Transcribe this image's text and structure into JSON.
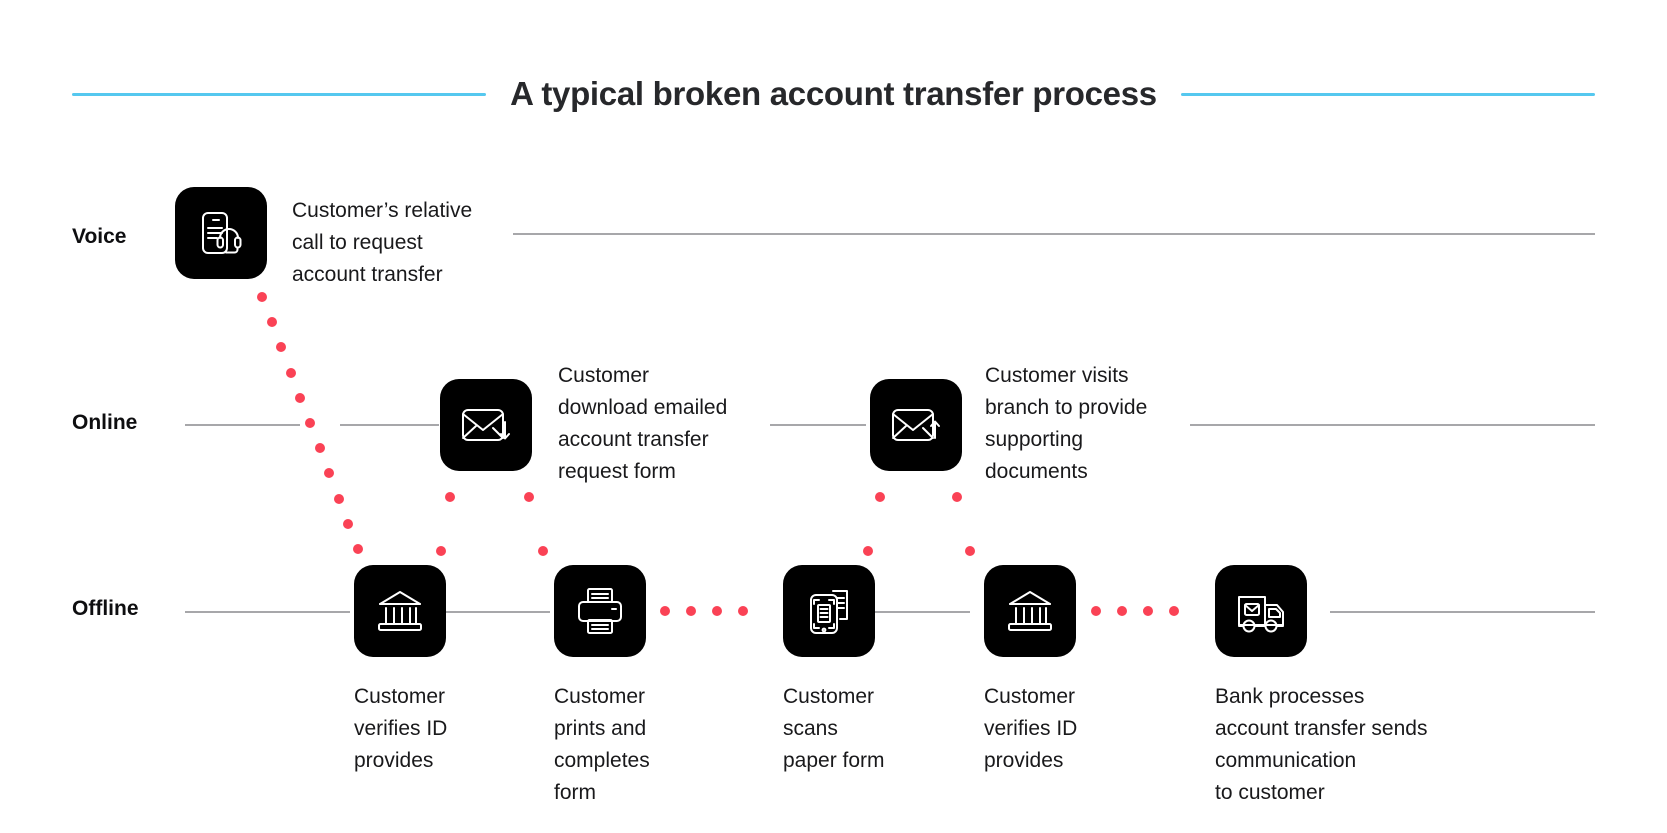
{
  "title": {
    "text": "A typical broken account transfer process",
    "rule_color": "#55c8ef"
  },
  "colors": {
    "accent_rule": "#55c8ef",
    "connector_dot": "#fa4255",
    "tile_background": "#000000",
    "track_line": "#a7a7aa",
    "text": "#19191b"
  },
  "lanes": [
    {
      "id": "voice",
      "label": "Voice"
    },
    {
      "id": "online",
      "label": "Online"
    },
    {
      "id": "offline",
      "label": "Offline"
    }
  ],
  "steps": [
    {
      "id": "step-1",
      "lane": "voice",
      "icon": "document-headset-icon",
      "caption": "Customer’s relative\ncall to request\naccount transfer",
      "caption_position": "right"
    },
    {
      "id": "step-2",
      "lane": "offline",
      "icon": "bank-icon",
      "caption": "Customer\nverifies ID\nprovides",
      "caption_position": "below"
    },
    {
      "id": "step-3",
      "lane": "online",
      "icon": "envelope-download-icon",
      "caption": "Customer\ndownload emailed\naccount transfer\nrequest form",
      "caption_position": "right"
    },
    {
      "id": "step-4",
      "lane": "offline",
      "icon": "printer-icon",
      "caption": "Customer\nprints and\ncompletes\nform",
      "caption_position": "below"
    },
    {
      "id": "step-5",
      "lane": "offline",
      "icon": "scanner-icon",
      "caption": "Customer\nscans\npaper form",
      "caption_position": "below"
    },
    {
      "id": "step-6",
      "lane": "online",
      "icon": "envelope-upload-icon",
      "caption": "Customer visits\nbranch to provide\nsupporting\ndocuments",
      "caption_position": "right"
    },
    {
      "id": "step-7",
      "lane": "offline",
      "icon": "bank-icon",
      "caption": "Customer\nverifies ID\nprovides",
      "caption_position": "below"
    },
    {
      "id": "step-8",
      "lane": "offline",
      "icon": "delivery-truck-mail-icon",
      "caption": "Bank processes\naccount transfer sends\ncommunication\nto customer",
      "caption_position": "below"
    }
  ]
}
